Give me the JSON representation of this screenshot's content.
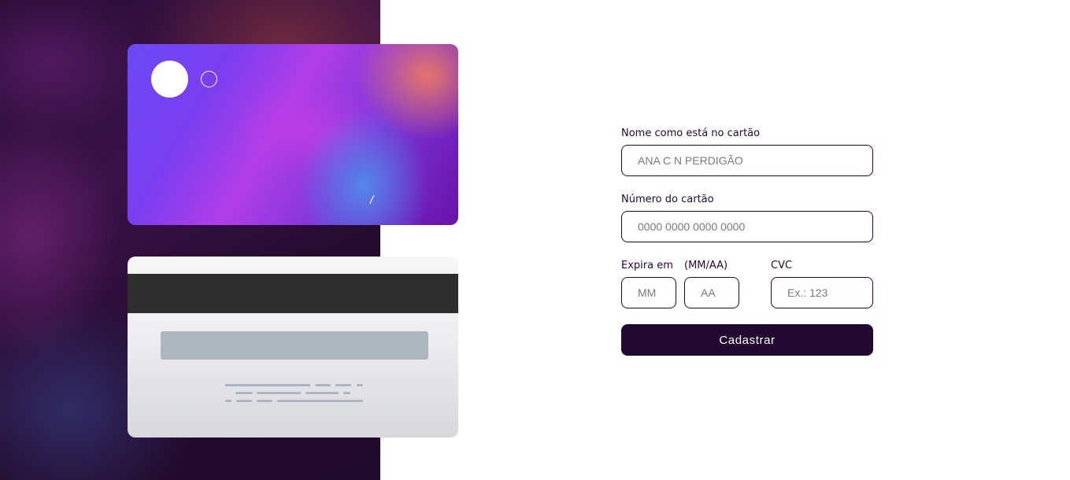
{
  "card_front": {
    "number": "",
    "holder": "",
    "expiry_separator": "/"
  },
  "form": {
    "name_label": "Nome como está no cartão",
    "name_placeholder": "ANA C N PERDIGÃO",
    "number_label": "Número do cartão",
    "number_placeholder": "0000 0000 0000 0000",
    "expiry_label": "Expira em",
    "expiry_format_label": "(MM/AA)",
    "month_placeholder": "MM",
    "year_placeholder": "AA",
    "cvc_label": "CVC",
    "cvc_placeholder": "Ex.: 123",
    "submit_label": "Cadastrar"
  },
  "colors": {
    "primary": "#21092f",
    "input_border": "#21092f",
    "placeholder": "#7a7a7a"
  }
}
